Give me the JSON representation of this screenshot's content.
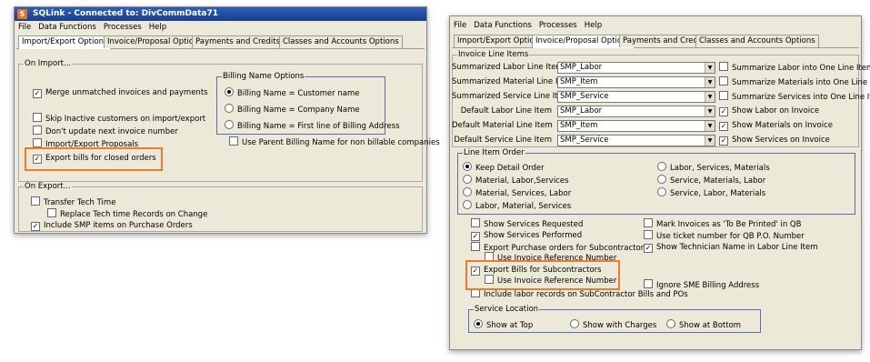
{
  "left_window": {
    "title": "SQLink - Connected to: DivCommData71",
    "app_icon": "S",
    "menu": [
      "File",
      "Data Functions",
      "Processes",
      "Help"
    ],
    "tabs": [
      "Import/Export Options",
      "Invoice/Proposal Options",
      "Payments and Credits",
      "Classes and Accounts Options"
    ],
    "on_import": {
      "label": "On Import...",
      "checks": [
        {
          "label": "Merge unmatched invoices and payments",
          "checked": true
        },
        {
          "label": "Skip Inactive customers on import/export",
          "checked": false
        },
        {
          "label": "Don't update next invoice number",
          "checked": false
        },
        {
          "label": "Import/Export Proposals",
          "checked": false
        },
        {
          "label": "Export bills for closed orders",
          "checked": true
        }
      ]
    },
    "billing": {
      "label": "Billing Name Options",
      "radios": [
        {
          "label": "Billing Name = Customer name",
          "selected": true
        },
        {
          "label": "Billing Name = Company Name",
          "selected": false
        },
        {
          "label": "Billing Name = First line of Billing Address",
          "selected": false
        }
      ],
      "parent_check": {
        "label": "Use Parent Billing Name for non billable companies",
        "checked": false
      }
    },
    "on_export": {
      "label": "On Export...",
      "checks": [
        {
          "label": "Transfer Tech Time",
          "checked": false
        },
        {
          "label": "Replace Tech time Records on Change",
          "checked": false
        },
        {
          "label": "Include SMP items on Purchase Orders",
          "checked": true
        }
      ]
    }
  },
  "right_window": {
    "menu": [
      "File",
      "Data Functions",
      "Processes",
      "Help"
    ],
    "tabs": [
      "Import/Export Options",
      "Invoice/Proposal Options",
      "Payments and Credits",
      "Classes and Accounts Options"
    ],
    "line_items": {
      "label": "Invoice Line Items",
      "rows": [
        {
          "label": "Summarized Labor Line Item",
          "value": "SMP_Labor",
          "check": "Summarize Labor into One Line Item",
          "checked": false
        },
        {
          "label": "Summarized Material Line Item",
          "value": "SMP_Item",
          "check": "Summarize Materials into One Line Item",
          "checked": false
        },
        {
          "label": "Summarized Service Line Item",
          "value": "SMP_Service",
          "check": "Summarize Services into One Line Item",
          "checked": false
        },
        {
          "label": "Default Labor Line Item",
          "value": "SMP_Labor",
          "check": "Show Labor on Invoice",
          "checked": true
        },
        {
          "label": "Default Material Line Item",
          "value": "SMP_Item",
          "check": "Show Materials on Invoice",
          "checked": true
        },
        {
          "label": "Default Service Line Item",
          "value": "SMP_Service",
          "check": "Show Services on Invoice",
          "checked": true
        }
      ]
    },
    "order": {
      "label": "Line Item Order",
      "left": [
        {
          "label": "Keep Detail Order",
          "selected": true
        },
        {
          "label": "Material, Labor,Services",
          "selected": false
        },
        {
          "label": "Material, Services, Labor",
          "selected": false
        },
        {
          "label": "Labor, Material, Services",
          "selected": false
        }
      ],
      "right": [
        {
          "label": "Labor, Services, Materials",
          "selected": false
        },
        {
          "label": "Service, Materials, Labor",
          "selected": false
        },
        {
          "label": "Service, Labor, Materials",
          "selected": false
        }
      ]
    },
    "options_left": [
      {
        "label": "Show Services Requested",
        "checked": false
      },
      {
        "label": "Show Services Performed",
        "checked": true
      },
      {
        "label": "Export Purchase orders for Subcontractors",
        "checked": false
      },
      {
        "label": "Use Invoice Reference Number",
        "checked": false
      },
      {
        "label": "Export Bills for Subcontractors",
        "checked": true
      },
      {
        "label": "Use Invoice Reference Number",
        "checked": false
      },
      {
        "label": "Include labor records on SubContractor Bills and POs",
        "checked": false
      }
    ],
    "options_right": [
      {
        "label": "Mark Invoices as 'To Be Printed' in QB",
        "checked": false
      },
      {
        "label": "Use ticket number for QB P.O. Number",
        "checked": false
      },
      {
        "label": "Show Technician Name in Labor Line Item",
        "checked": true
      },
      {
        "label": "Ignore SME Billing Address",
        "checked": false
      }
    ],
    "service_location": {
      "label": "Service Location",
      "radios": [
        {
          "label": "Show at Top",
          "selected": true
        },
        {
          "label": "Show with Charges",
          "selected": false
        },
        {
          "label": "Show at Bottom",
          "selected": false
        }
      ]
    }
  },
  "highlight_color": "#ee7b2b"
}
